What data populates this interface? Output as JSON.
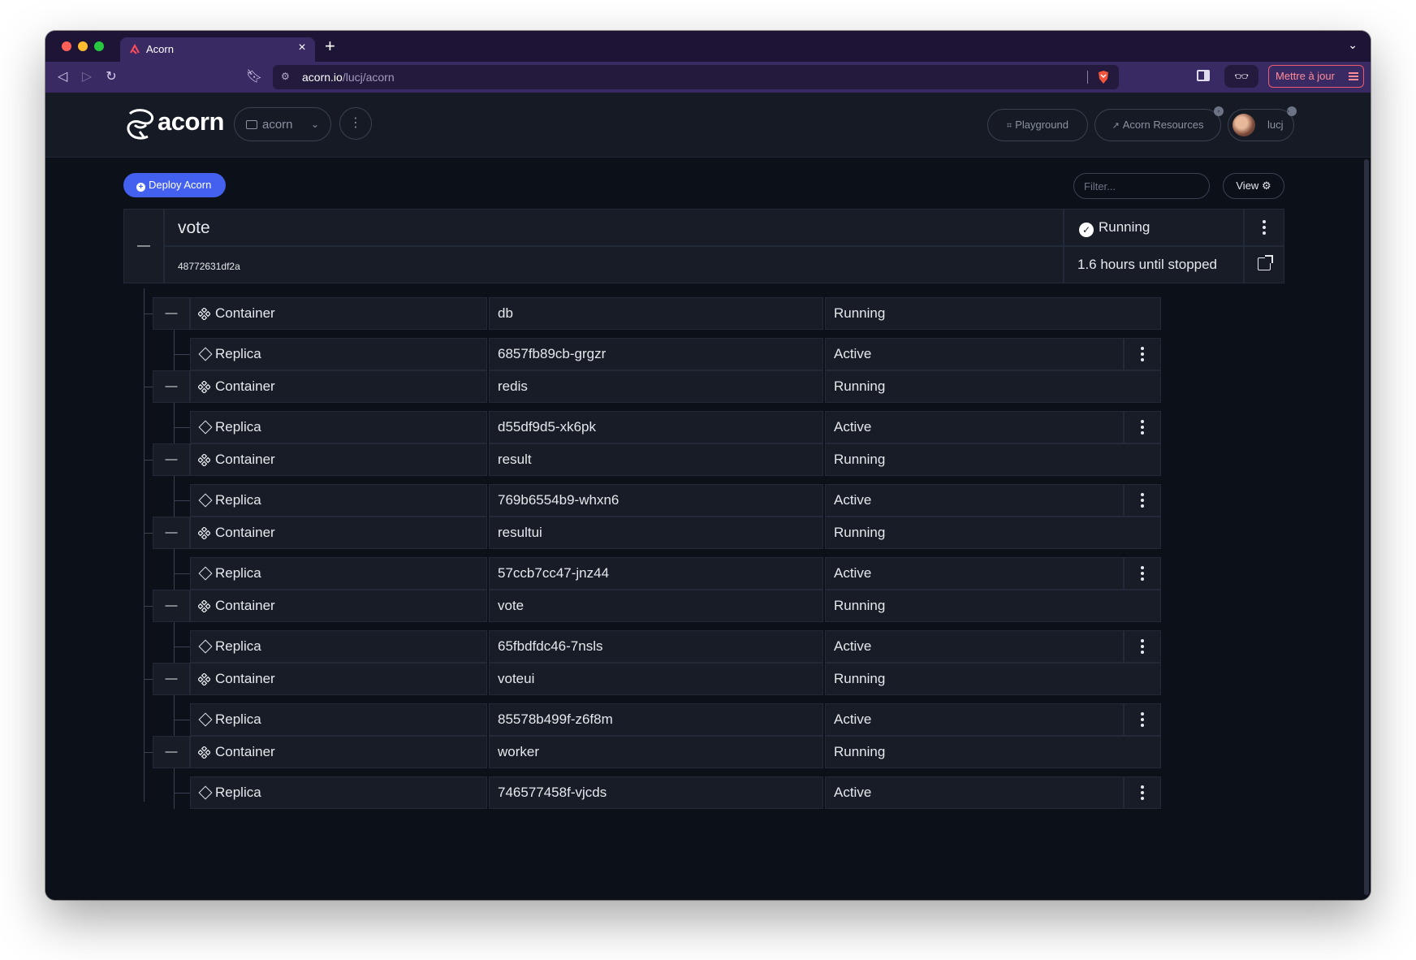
{
  "browser": {
    "tab_title": "Acorn",
    "url_host": "acorn.io",
    "url_path": "/lucj/acorn",
    "update_label": "Mettre à jour"
  },
  "header": {
    "logo_text": "acorn",
    "project": "acorn",
    "playground_label": "Playground",
    "resources_label": "Acorn Resources",
    "user": "lucj"
  },
  "toolbar": {
    "deploy_label": "Deploy Acorn",
    "filter_placeholder": "Filter...",
    "view_label": "View"
  },
  "app": {
    "name": "vote",
    "id": "48772631df2a",
    "status": "Running",
    "time_left": "1.6 hours until stopped"
  },
  "rows": [
    {
      "container": {
        "kind": "Container",
        "name": "db",
        "status": "Running"
      },
      "replica": {
        "kind": "Replica",
        "name": "6857fb89cb-grgzr",
        "status": "Active"
      }
    },
    {
      "container": {
        "kind": "Container",
        "name": "redis",
        "status": "Running"
      },
      "replica": {
        "kind": "Replica",
        "name": "d55df9d5-xk6pk",
        "status": "Active"
      }
    },
    {
      "container": {
        "kind": "Container",
        "name": "result",
        "status": "Running"
      },
      "replica": {
        "kind": "Replica",
        "name": "769b6554b9-whxn6",
        "status": "Active"
      }
    },
    {
      "container": {
        "kind": "Container",
        "name": "resultui",
        "status": "Running"
      },
      "replica": {
        "kind": "Replica",
        "name": "57ccb7cc47-jnz44",
        "status": "Active"
      }
    },
    {
      "container": {
        "kind": "Container",
        "name": "vote",
        "status": "Running"
      },
      "replica": {
        "kind": "Replica",
        "name": "65fbdfdc46-7nsls",
        "status": "Active"
      }
    },
    {
      "container": {
        "kind": "Container",
        "name": "voteui",
        "status": "Running"
      },
      "replica": {
        "kind": "Replica",
        "name": "85578b499f-z6f8m",
        "status": "Active"
      }
    },
    {
      "container": {
        "kind": "Container",
        "name": "worker",
        "status": "Running"
      },
      "replica": {
        "kind": "Replica",
        "name": "746577458f-vjcds",
        "status": "Active"
      }
    }
  ],
  "icons": {
    "container": "container-icon",
    "replica": "replica-icon",
    "menu": "kebab-icon",
    "status_ok": "check-circle-icon"
  },
  "colors": {
    "accent": "#4361ee",
    "background": "#0c1019",
    "panel": "#171c26",
    "update_red": "#f05a6e"
  }
}
